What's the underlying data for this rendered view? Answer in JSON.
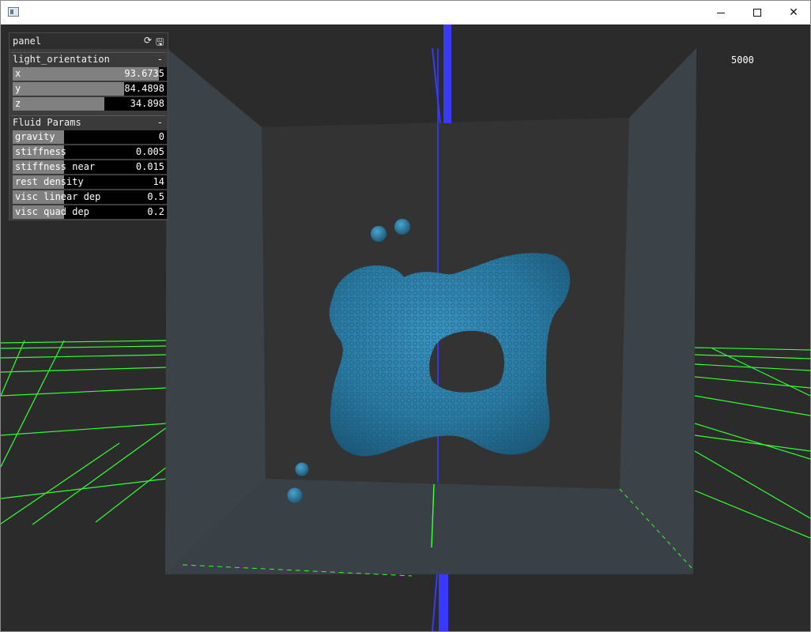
{
  "viewport": {
    "counter": "5000"
  },
  "panel": {
    "title": "panel",
    "icons": [
      "refresh-icon",
      "save-icon"
    ],
    "groups": [
      {
        "title": "light_orientation",
        "toggle": "-",
        "sliders": [
          {
            "label": "x",
            "value": "93.6735",
            "fill": 0.95
          },
          {
            "label": "y",
            "value": "84.4898",
            "fill": 0.72
          },
          {
            "label": "z",
            "value": "34.898",
            "fill": 0.6
          }
        ]
      },
      {
        "title": "Fluid Params",
        "toggle": "-",
        "sliders": [
          {
            "label": "gravity",
            "value": "0",
            "fill": 0.33
          },
          {
            "label": "stiffness",
            "value": "0.005",
            "fill": 0.33
          },
          {
            "label": "stiffness near",
            "value": "0.015",
            "fill": 0.33
          },
          {
            "label": "rest density",
            "value": "14",
            "fill": 0.33
          },
          {
            "label": "visc linear dep",
            "value": "0.5",
            "fill": 0.33
          },
          {
            "label": "visc quad dep",
            "value": "0.2",
            "fill": 0.33
          }
        ]
      }
    ]
  },
  "colors": {
    "background": "#2b2b2b",
    "box_wall": "#3b4349",
    "box_back": "#333333",
    "grid": "#33ff33",
    "axis": "#3a3aff",
    "fluid": "#2e7ea8"
  }
}
